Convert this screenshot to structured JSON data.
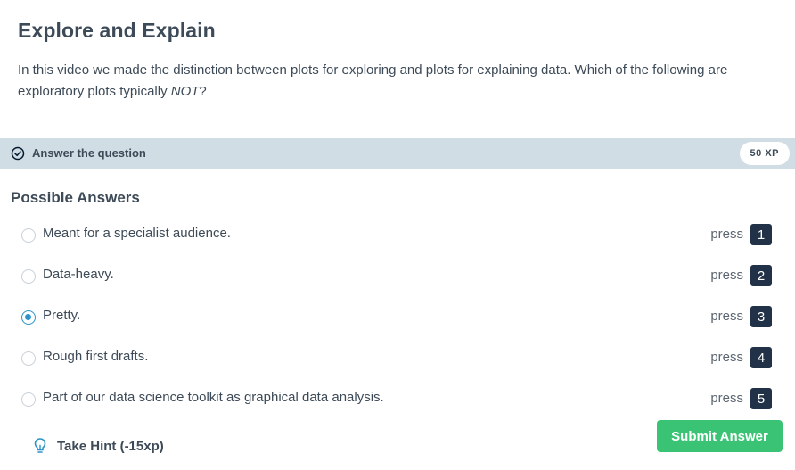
{
  "exercise": {
    "title": "Explore and Explain",
    "question_text": "In this video we made the distinction between plots for exploring and plots for explaining data. Which of the following are exploratory plots typically ",
    "question_emphasis": "NOT",
    "question_end": "?"
  },
  "task_bar": {
    "icon": "check-circle-icon",
    "label": "Answer the question",
    "xp": "50 XP"
  },
  "answers": {
    "heading": "Possible Answers",
    "press_label": "press",
    "selected_index": 2,
    "options": [
      {
        "label": "Meant for a specialist audience.",
        "key": "1"
      },
      {
        "label": "Data-heavy.",
        "key": "2"
      },
      {
        "label": "Pretty.",
        "key": "3"
      },
      {
        "label": "Rough first drafts.",
        "key": "4"
      },
      {
        "label": "Part of our data science toolkit as graphical data analysis.",
        "key": "5"
      }
    ]
  },
  "hint": {
    "icon": "lightbulb-icon",
    "label": "Take Hint (-15xp)"
  },
  "submit": {
    "label": "Submit Answer",
    "color": "#3ac374"
  },
  "colors": {
    "task_bar_bg": "#d0dde4",
    "key_badge_bg": "#213147",
    "radio_selected": "#2c94c8"
  }
}
